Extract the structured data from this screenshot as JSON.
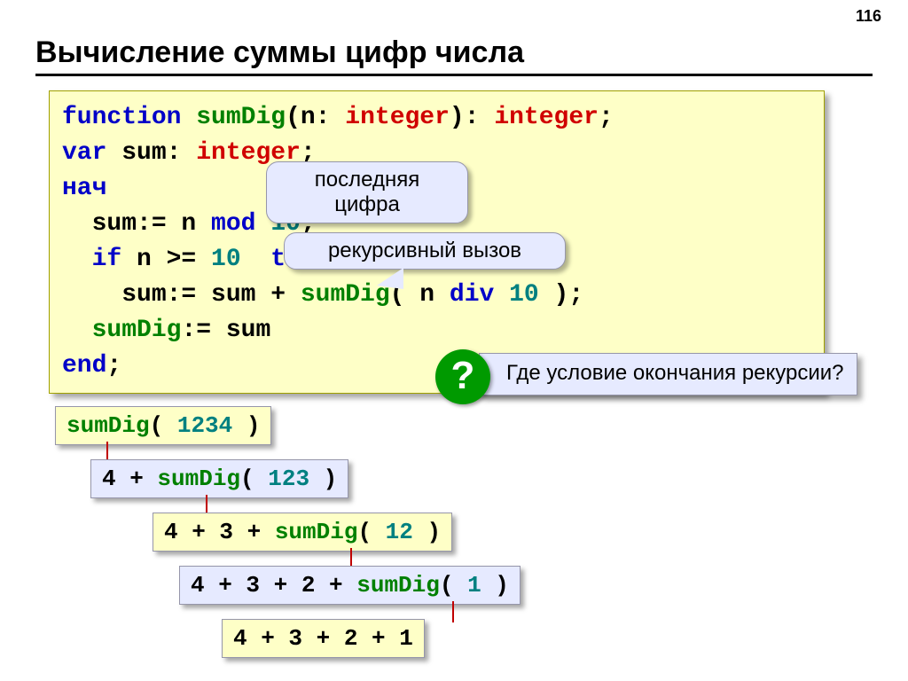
{
  "page_number": "116",
  "title": "Вычисление суммы цифр числа",
  "code": {
    "l1": {
      "t1": "function",
      "t2": " ",
      "t3": "sumDig",
      "t4": "(n: ",
      "t5": "integer",
      "t6": "): ",
      "t7": "integer",
      "t8": ";"
    },
    "l2": {
      "t1": "var",
      "t2": " sum: ",
      "t3": "integer",
      "t4": ";"
    },
    "l3": {
      "t1": "нач"
    },
    "l4": {
      "t1": "  sum:= n ",
      "t2": "mod",
      "t3": " ",
      "t4": "10",
      "t5": ";"
    },
    "l5": {
      "t1": "  ",
      "t2": "if",
      "t3": " n >= ",
      "t4": "10",
      "t5": "  ",
      "t6": "then"
    },
    "l6": {
      "t1": "    sum:= sum + ",
      "t2": "sumDig",
      "t3": "( n ",
      "t4": "div",
      "t5": " ",
      "t6": "10",
      "t7": " );"
    },
    "l7": {
      "t1": "  ",
      "t2": "sumDig",
      "t3": ":= sum"
    },
    "l8": {
      "t1": "end",
      "t2": ";"
    }
  },
  "callout1": "последняя цифра",
  "callout2": "рекурсивный вызов",
  "question_mark": "?",
  "question_text": "Где условие окончания рекурсии?",
  "steps": {
    "s1": {
      "a": "sumDig",
      "b": "( ",
      "c": "1234",
      "d": " )"
    },
    "s2": {
      "a": "4 + ",
      "b": "sumDig",
      "c": "( ",
      "d": "123",
      "e": " )"
    },
    "s3": {
      "a": "4 + 3 + ",
      "b": "sumDig",
      "c": "( ",
      "d": "12",
      "e": " )"
    },
    "s4": {
      "a": "4 + 3 + 2 + ",
      "b": "sumDig",
      "c": "( ",
      "d": "1",
      "e": " )"
    },
    "s5": {
      "a": "4 + 3 + 2 + 1"
    }
  }
}
